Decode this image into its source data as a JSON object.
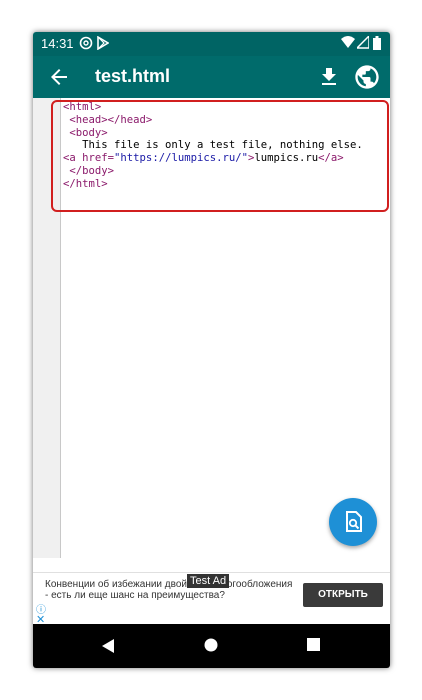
{
  "status": {
    "time": "14:31",
    "icons": [
      "at-sign-icon",
      "play-store-icon",
      "wifi-icon",
      "signal-icon",
      "battery-icon"
    ]
  },
  "toolbar": {
    "title": "test.html",
    "back_icon": "arrow-left-icon",
    "download_icon": "download-icon",
    "globe_icon": "globe-icon"
  },
  "editor": {
    "lines": {
      "l1_tag": "<html>",
      "l2_tag": "<head></head>",
      "l3_tag": "<body>",
      "l4_text": "This file is only a test file, nothing else.",
      "l5_open": "<a",
      "l5_attr": "href=",
      "l5_val": "\"https://lumpics.ru/\"",
      "l5_close": ">",
      "l5_text": "lumpics.ru",
      "l5_end": "</a>",
      "l6_tag": "</body>",
      "l7_tag": "</html>"
    }
  },
  "fab": {
    "icon": "find-in-page-icon"
  },
  "ad": {
    "label": "Test Ad",
    "text": "Конвенции об избежании двойного налогообложения - есть ли еще шанс на преимущества?",
    "button": "ОТКРЫТЬ",
    "info_icon": "info-icon",
    "close_icon": "close-icon"
  },
  "nav": {
    "icons": [
      "nav-back-icon",
      "nav-home-icon",
      "nav-recents-icon"
    ]
  },
  "colors": {
    "status_bar": "#006464",
    "toolbar": "#006b6b",
    "fab": "#1e90d6",
    "highlight": "#d11f1f"
  }
}
